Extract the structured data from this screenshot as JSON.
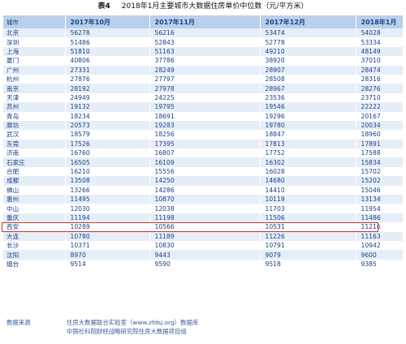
{
  "title": {
    "label": "表4",
    "text": "2018年1月主要城市大数据住房单价中位数（元/平方米）"
  },
  "table": {
    "headers": [
      "城市",
      "2017年10月",
      "2017年11月",
      "2017年12月",
      "2018年1月"
    ],
    "rows": [
      [
        "北京",
        "56278",
        "56216",
        "53474",
        "54028"
      ],
      [
        "深圳",
        "51486",
        "52843",
        "52778",
        "53334"
      ],
      [
        "上海",
        "51810",
        "51163",
        "49210",
        "48149"
      ],
      [
        "厦门",
        "40806",
        "37786",
        "38920",
        "37010"
      ],
      [
        "广州",
        "27331",
        "28249",
        "28907",
        "28474"
      ],
      [
        "杭州",
        "27876",
        "27797",
        "28508",
        "28316"
      ],
      [
        "南京",
        "28192",
        "27978",
        "28967",
        "28276"
      ],
      [
        "天津",
        "24949",
        "24225",
        "23536",
        "23710"
      ],
      [
        "苏州",
        "19132",
        "19795",
        "19546",
        "22222"
      ],
      [
        "青岛",
        "18234",
        "18691",
        "19296",
        "20167"
      ],
      [
        "廊坊",
        "20573",
        "19283",
        "19780",
        "20034"
      ],
      [
        "武汉",
        "18579",
        "18256",
        "18847",
        "18960"
      ],
      [
        "东莞",
        "17526",
        "17395",
        "17813",
        "17891"
      ],
      [
        "济南",
        "16760",
        "16807",
        "17752",
        "17588"
      ],
      [
        "石家庄",
        "16505",
        "16109",
        "16302",
        "15834"
      ],
      [
        "合肥",
        "16210",
        "15556",
        "16028",
        "15702"
      ],
      [
        "成都",
        "13508",
        "14250",
        "14680",
        "15202"
      ],
      [
        "佛山",
        "13266",
        "14286",
        "14410",
        "15046"
      ],
      [
        "惠州",
        "11495",
        "10870",
        "10119",
        "13134"
      ],
      [
        "中山",
        "12030",
        "12038",
        "11703",
        "11954"
      ],
      [
        "重庆",
        "11194",
        "11198",
        "11506",
        "11486"
      ],
      [
        "西安",
        "10289",
        "10566",
        "10531",
        "11216"
      ],
      [
        "大连",
        "10780",
        "11189",
        "11226",
        "11163"
      ],
      [
        "长沙",
        "10371",
        "10830",
        "10791",
        "10942"
      ],
      [
        "沈阳",
        "8970",
        "9443",
        "9079",
        "9600"
      ],
      [
        "烟台",
        "9514",
        "9590",
        "9518",
        "9385"
      ]
    ],
    "highlighted_row": 21,
    "highlight_color": "#c0392b"
  },
  "footer": {
    "source_label": "数据来源",
    "source_line1": "住房大数据联合实验室（www.zfdsj.org）数据库",
    "source_line2": "中国社科院财经战略研究院住房大数据项目组"
  }
}
